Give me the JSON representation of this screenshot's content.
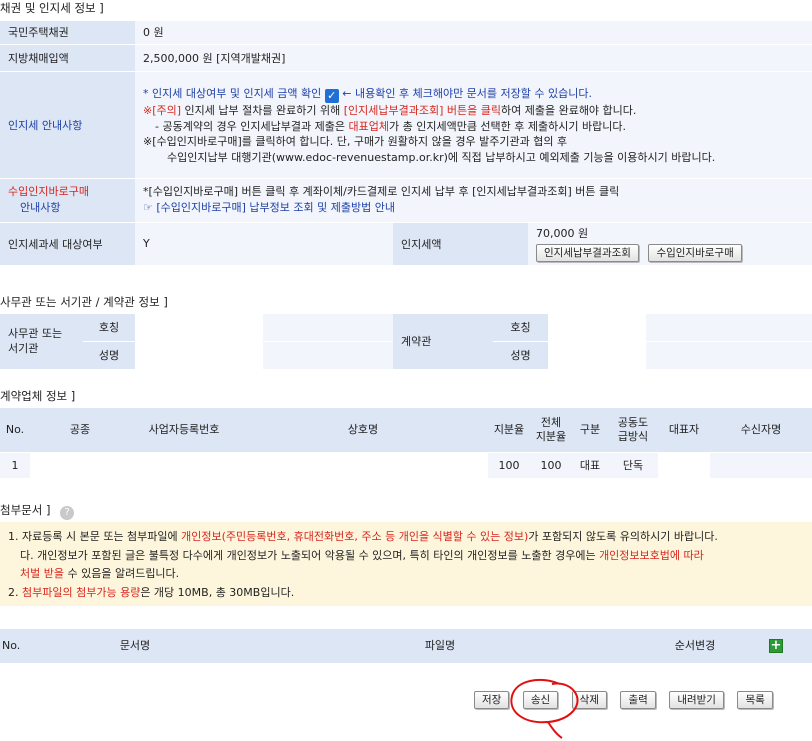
{
  "bond_section": {
    "title": "채권 및 인지세 정보 ]",
    "housing_bond_label": "국민주택채권",
    "housing_bond_value": "0 원",
    "local_bond_label": "지방채매입액",
    "local_bond_value": "2,500,000 원  [지역개발채권]",
    "stamp_tax_label": "인지세 안내사항",
    "stamp_line1_a": "* 인지세 대상여부 및 인지세 금액 확인",
    "stamp_line1_b": "← 내용확인 후 체크해야만 문서를 저장할 수 있습니다.",
    "stamp_line2_a": "※[주의]",
    "stamp_line2_b": " 인지세 납부 절차를 완료하기 위해 ",
    "stamp_line2_c": "[인지세납부결과조회] 버튼을 클릭",
    "stamp_line2_d": "하여 제출을 완료해야 합니다.",
    "stamp_line3_a": "- 공동계약의 경우 인지세납부결과 제출은 ",
    "stamp_line3_b": "대표업체",
    "stamp_line3_c": "가 총 인지세액만큼 선택한 후 제출하시기 바랍니다.",
    "stamp_line4": "※[수입인지바로구매]를 클릭하여 합니다. 단, 구매가 원활하지 않을 경우 발주기관과 협의 후",
    "stamp_line5": "수입인지납부 대행기관(www.edoc-revenuestamp.or.kr)에 직접 납부하시고 예외제출 기능을 이용하시기 바랍니다.",
    "purchase_label_1": "수입인지바로구매",
    "purchase_label_2": "안내사항",
    "purchase_line1": "*[수입인지바로구매] 버튼 클릭 후 계좌이체/카드결제로 인지세 납부 후 [인지세납부결과조회] 버튼 클릭",
    "purchase_line2": "☞ [수입인지바로구매] 납부정보 조회 및 제출방법 안내",
    "taxable_label": "인지세과세 대상여부",
    "taxable_value": "Y",
    "stamp_amount_label": "인지세액",
    "stamp_amount_value": "70,000 원",
    "btn_result": "인지세납부결과조회",
    "btn_buy": "수입인지바로구매"
  },
  "office_section": {
    "title": "사무관 또는 서기관 / 계약관 정보 ]",
    "officer_label_1": "사무관 또는",
    "officer_label_2": "서기관",
    "title_label": "호칭",
    "name_label": "성명",
    "contract_label": "계약관",
    "title_label_2": "호칭",
    "name_label_2": "성명"
  },
  "company_section": {
    "title": "계약업체 정보 ]",
    "headers": [
      "No.",
      "공종",
      "사업자등록번호",
      "상호명",
      "지분율",
      "전체 지분율",
      "구분",
      "공동도 급방식",
      "대표자",
      "수신자명"
    ],
    "header_total_1": "전체",
    "header_total_2": "지분율",
    "header_joint_1": "공동도",
    "header_joint_2": "급방식",
    "row": {
      "no": "1",
      "share": "100",
      "total_share": "100",
      "type": "대표",
      "method": "단독"
    }
  },
  "attach_section": {
    "title": "첨부문서 ]",
    "n1_a": "1. 자료등록 시 본문 또는 첨부파일에 ",
    "n1_b": "개인정보(주민등록번호, 휴대전화번호, 주소 등 개인을 식별할 수 있는 정보)",
    "n1_c": "가 포함되지 않도록 유의하시기 바랍니다.",
    "n2_a": "다. 개인정보가 포함된 글은 불특정 다수에게 개인정보가 노출되어 악용될 수 있으며, 특히 타인의 개인정보를 노출한 경우에는 ",
    "n2_b": "개인정보보호법에 따라",
    "n3": "처벌 받을",
    "n3_b": " 수 있음을 알려드립니다.",
    "n4_a": "2. ",
    "n4_b": "첨부파일의 첨부가능 용량",
    "n4_c": "은 개당 10MB, 총 30MB입니다.",
    "col_no": "No.",
    "col_doc": "문서명",
    "col_file": "파일명",
    "col_order": "순서변경"
  },
  "actions": {
    "save": "저장",
    "send": "송신",
    "delete": "삭제",
    "print": "출력",
    "download": "내려받기",
    "list": "목록"
  },
  "colors": {
    "label_bg": "#dde6f5",
    "value_bg": "#f2f5fb",
    "red": "#d8261e",
    "blue": "#1c3fa8",
    "annotation": "#e01010"
  }
}
